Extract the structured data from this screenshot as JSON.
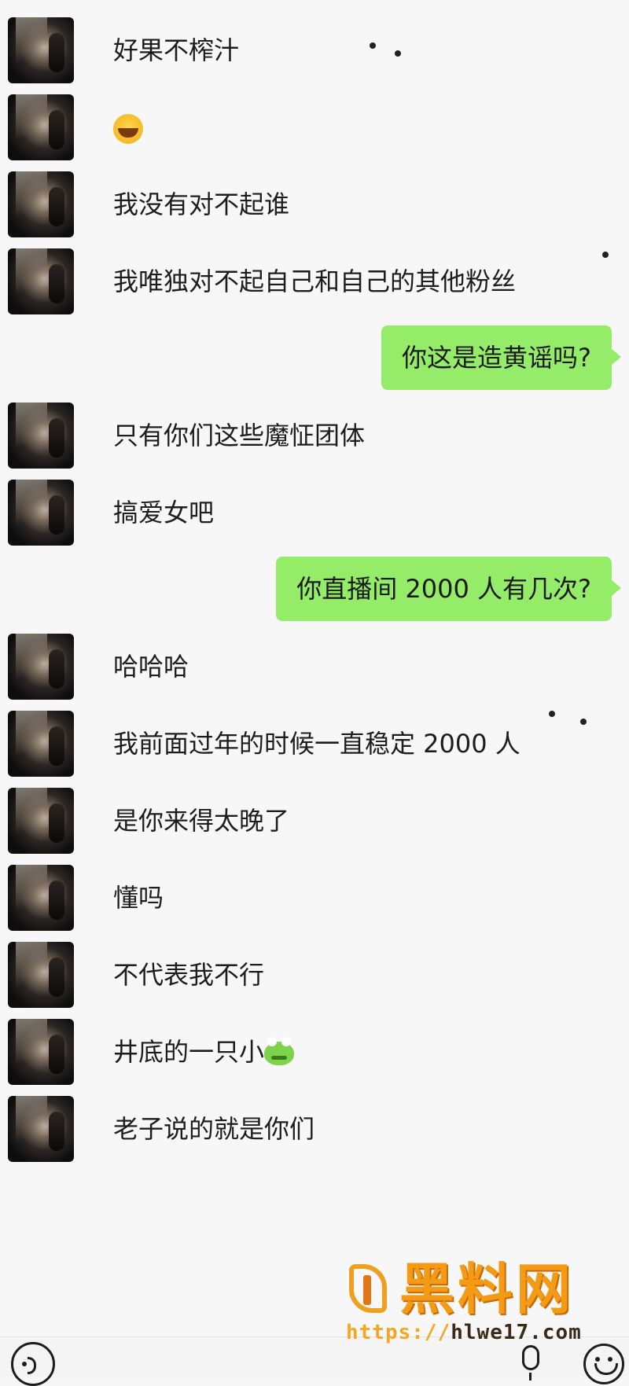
{
  "chat": {
    "messages": [
      {
        "side": "left",
        "text": "好果不榨汁"
      },
      {
        "side": "left",
        "emoji": "facepalm-emoji"
      },
      {
        "side": "left",
        "text": "我没有对不起谁"
      },
      {
        "side": "left",
        "text": "我唯独对不起自己和自己的其他粉丝"
      },
      {
        "side": "right",
        "text": "你这是造黄谣吗?"
      },
      {
        "side": "left",
        "text": "只有你们这些魔怔团体"
      },
      {
        "side": "left",
        "text": "搞爱女吧"
      },
      {
        "side": "right",
        "text": "你直播间 2000 人有几次?"
      },
      {
        "side": "left",
        "text": "哈哈哈"
      },
      {
        "side": "left",
        "text": "我前面过年的时候一直稳定 2000 人"
      },
      {
        "side": "left",
        "text": "是你来得太晚了"
      },
      {
        "side": "left",
        "text": "懂吗"
      },
      {
        "side": "left",
        "text": "不代表我不行"
      },
      {
        "side": "left",
        "text": "井底的一只小",
        "emoji": "frog-emoji"
      },
      {
        "side": "left",
        "text": "老子说的就是你们"
      }
    ]
  },
  "watermark": {
    "title": "黑料网",
    "url_prefix": "https://",
    "url_domain": "hlwe17.com"
  },
  "colors": {
    "bubble_self": "#95ec69",
    "background": "#f7f7f7",
    "watermark": "#f59a14"
  },
  "input_bar": {
    "icons": [
      "voice-toggle-icon",
      "microphone-icon",
      "emoji-icon"
    ]
  }
}
